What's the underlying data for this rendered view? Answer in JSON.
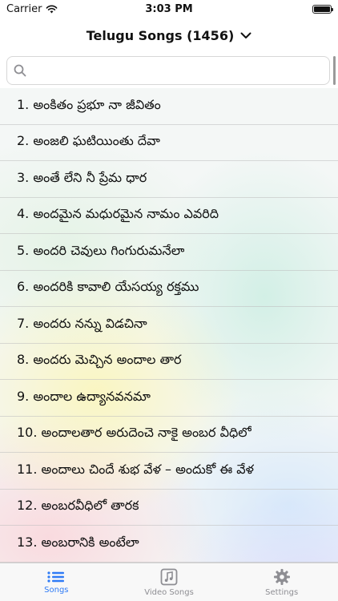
{
  "status_bar": {
    "carrier": "Carrier",
    "time": "3:03 PM"
  },
  "nav": {
    "title": "Telugu Songs (1456)"
  },
  "search": {
    "value": "",
    "placeholder": ""
  },
  "songs": [
    "1. అంకితం ప్రభూ నా జీవితం",
    "2. అంజలి ఘటియింతు దేవా",
    "3. అంతే లేని నీ ప్రేమ ధార",
    "4. అందమైన మధురమైన నామం ఎవరిది",
    "5. అందరి చెవులు గింగురుమనేలా",
    "6. అందరికి కావాలి యేసయ్య రక్తము",
    "7. అందరు నన్ను విడచినా",
    "8. అందరు మెచ్చిన అందాల తార",
    "9. అందాల ఉద్యానవనమా",
    "10. అందాలతార అరుదెంచె నాకై అంబర వీధిలో",
    "11. అందాలు చిందే శుభ వేళ – అందుకో ఈ వేళ",
    "12. అంబరవీధిలో తారక",
    "13. అంబరానికి అంటేలా"
  ],
  "tabs": [
    {
      "label": "Songs",
      "icon": "list-icon",
      "active": true
    },
    {
      "label": "Video Songs",
      "icon": "music-note-icon",
      "active": false
    },
    {
      "label": "Settings",
      "icon": "gear-icon",
      "active": false
    }
  ],
  "colors": {
    "accent": "#2f7bf6",
    "inactive": "#8e8e93"
  }
}
